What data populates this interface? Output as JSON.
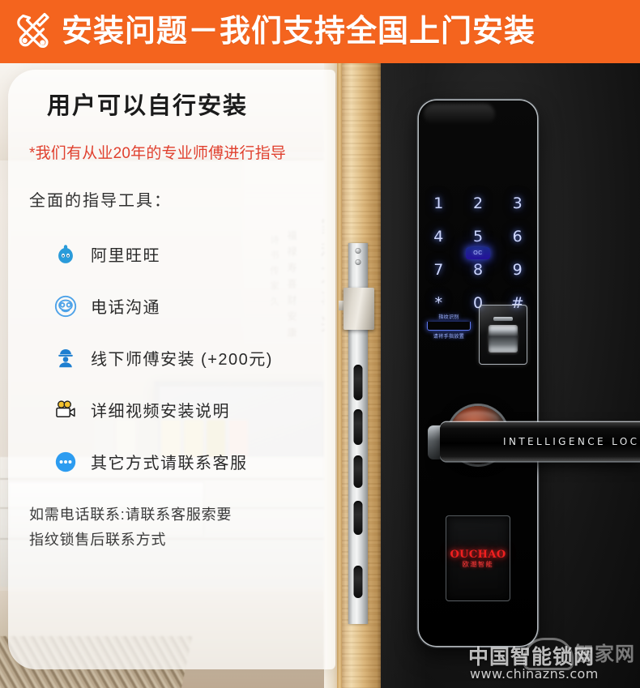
{
  "banner": {
    "icon": "tools-wrench-screwdriver-icon",
    "title": "安装问题－我们支持全国上门安装",
    "bg_color": "#f4641e",
    "text_color": "#ffffff"
  },
  "card": {
    "heading": "用户可以自行安装",
    "highlight": "*我们有从业20年的专业师傅进行指导",
    "highlight_color": "#e0402e",
    "subheading": "全面的指导工具：",
    "items": [
      {
        "icon": "wangwang-icon",
        "label": "阿里旺旺",
        "color": "#2a9bda"
      },
      {
        "icon": "telephone-icon",
        "label": "电话沟通",
        "color": "#4da2e8"
      },
      {
        "icon": "worker-icon",
        "label": "线下师傅安装 (+200元)",
        "color": "#1f7fd0"
      },
      {
        "icon": "video-camera-icon",
        "label": "详细视频安装说明",
        "color": "#f2c12e"
      },
      {
        "icon": "more-dots-icon",
        "label": "其它方式请联系客服",
        "color": "#2d9cf0"
      }
    ],
    "note_line1": "如需电话联系:请联系客服索要",
    "note_line2": "指纹锁售后联系方式"
  },
  "lock": {
    "keypad": [
      "1",
      "2",
      "3",
      "4",
      "5",
      "6",
      "7",
      "8",
      "9",
      "*",
      "0",
      "#"
    ],
    "key_glow_color": "#cfd8ff",
    "brand_led_text": "OC",
    "fingerprint": {
      "top_label": "指纹识别",
      "bottom_label": "请将手指放置",
      "sensor": "fingerprint-sensor"
    },
    "handle_text": "INTELLIGENCE LOCK",
    "logo_en": "OUCHAO",
    "logo_cn": "欧潮智能",
    "logo_color": "#f02020"
  },
  "watermark": {
    "line1": "中国智能锁网",
    "line2": "www.chinazns.com",
    "ghost": "智家网"
  }
}
